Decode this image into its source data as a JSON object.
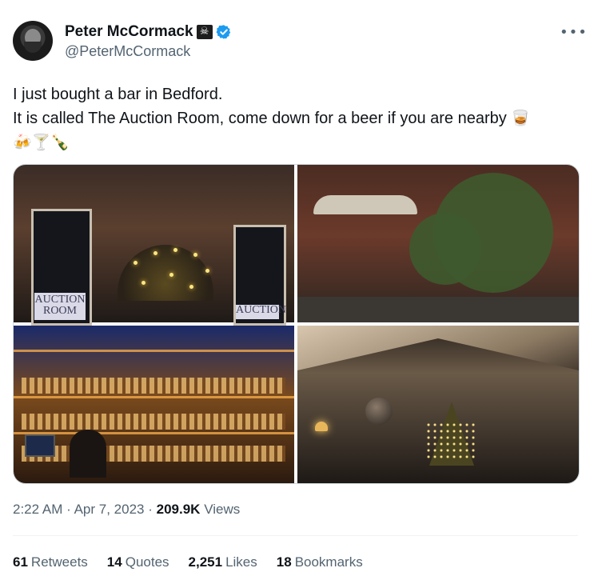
{
  "author": {
    "name": "Peter McCormack",
    "handle": "@PeterMcCormack",
    "name_emoji": "☠",
    "verified": true
  },
  "more_icon": "•••",
  "tweet": {
    "line1": "I just bought a bar in Bedford.",
    "line2": "It is called The Auction Room, come down for a beer if you are nearby",
    "line2_emoji": "🥃",
    "line3_emoji": "🍻🍸🍾"
  },
  "photos": {
    "sign_left": "AUCTION ROOM",
    "sign_right": "AUCTION"
  },
  "meta": {
    "time": "2:22 AM",
    "sep1": "·",
    "date": "Apr 7, 2023",
    "sep2": "·",
    "views_count": "209.9K",
    "views_label": "Views"
  },
  "stats": {
    "retweets_count": "61",
    "retweets_label": "Retweets",
    "quotes_count": "14",
    "quotes_label": "Quotes",
    "likes_count": "2,251",
    "likes_label": "Likes",
    "bookmarks_count": "18",
    "bookmarks_label": "Bookmarks"
  },
  "colors": {
    "verified": "#1d9bf0",
    "text_primary": "#0f1419",
    "text_secondary": "#536471"
  }
}
